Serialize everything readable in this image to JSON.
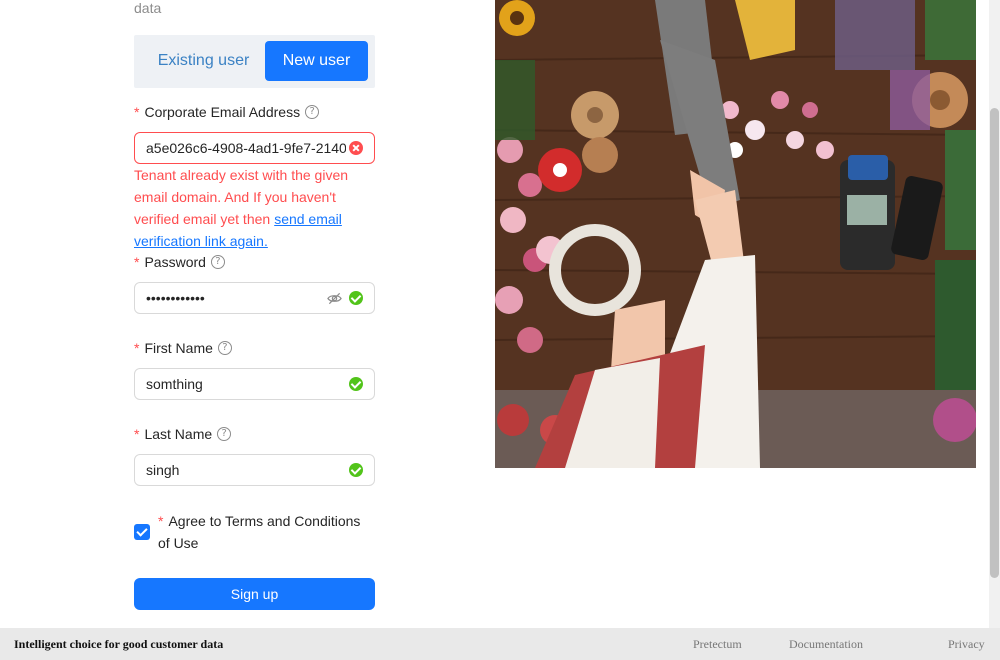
{
  "top_fragment": "data",
  "user_toggle": {
    "existing": "Existing user",
    "new": "New user"
  },
  "email": {
    "label": "Corporate Email Address",
    "value": "a5e026c6-4908-4ad1-9fe7-2140",
    "error": "Tenant already exist with the given email domain. And If you haven't verified email yet then",
    "error_link": "send email verification link again."
  },
  "password": {
    "label": "Password",
    "value": "••••••••••••"
  },
  "first_name": {
    "label": "First Name",
    "value": "somthing"
  },
  "last_name": {
    "label": "Last Name",
    "value": "singh"
  },
  "required_mark": "*",
  "help_glyph": "?",
  "agree": {
    "text": "Agree to Terms and Conditions of Use",
    "checked": true
  },
  "signup_label": "Sign up",
  "footer": {
    "tagline": "Intelligent choice for good customer data",
    "links": [
      "Pretectum",
      "Documentation",
      "Privacy"
    ]
  },
  "colors": {
    "primary": "#1677ff",
    "error": "#ff4d4f",
    "success": "#52c41a"
  }
}
